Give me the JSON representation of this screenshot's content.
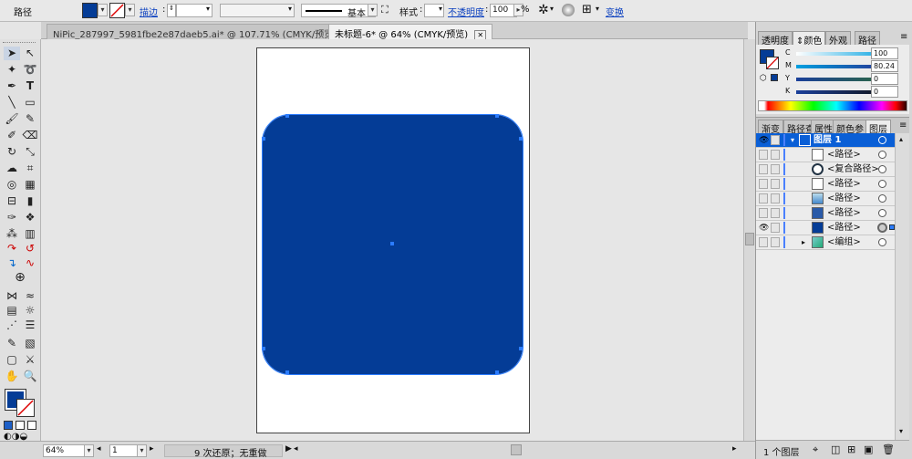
{
  "control_bar": {
    "object_type": "路径",
    "stroke_label": "描边",
    "stroke_profile": "基本",
    "style_label": "样式",
    "opacity_label": "不透明度",
    "opacity_value": "100",
    "opacity_unit": "%",
    "transform_label": "变换"
  },
  "doc_tabs": [
    {
      "label": "NiPic_287997_5981fbe2e87daeb5.ai* @ 107.71% (CMYK/预览)",
      "active": false
    },
    {
      "label": "未标题-6* @ 64% (CMYK/预览)",
      "active": true
    }
  ],
  "status_bar": {
    "zoom": "64%",
    "artboard": "1",
    "history": "9 次还原；无重做"
  },
  "colors": {
    "fill": "#043c96",
    "accent": "#0a5fd6"
  },
  "color_panel": {
    "tabs": [
      "透明度",
      "颜色",
      "外观",
      "路径"
    ],
    "active_tab": "颜色",
    "channels": [
      {
        "name": "C",
        "value": "100",
        "fraction": 1.0
      },
      {
        "name": "M",
        "value": "80.24",
        "fraction": 0.8024
      },
      {
        "name": "Y",
        "value": "0",
        "fraction": 0.0
      },
      {
        "name": "K",
        "value": "0",
        "fraction": 0.0
      }
    ]
  },
  "layers_panel": {
    "tabs": [
      "渐变",
      "路径查",
      "属性",
      "颜色参",
      "图层"
    ],
    "active_tab": "图层",
    "layer_name": "图层 1",
    "items": [
      {
        "name": "<路径>",
        "visible": false
      },
      {
        "name": "<复合路径>",
        "visible": false
      },
      {
        "name": "<路径>",
        "visible": false
      },
      {
        "name": "<路径>",
        "visible": false
      },
      {
        "name": "<路径>",
        "visible": false
      },
      {
        "name": "<路径>",
        "visible": true
      },
      {
        "name": "<编组>",
        "visible": false
      }
    ],
    "footer": "1 个图层"
  }
}
